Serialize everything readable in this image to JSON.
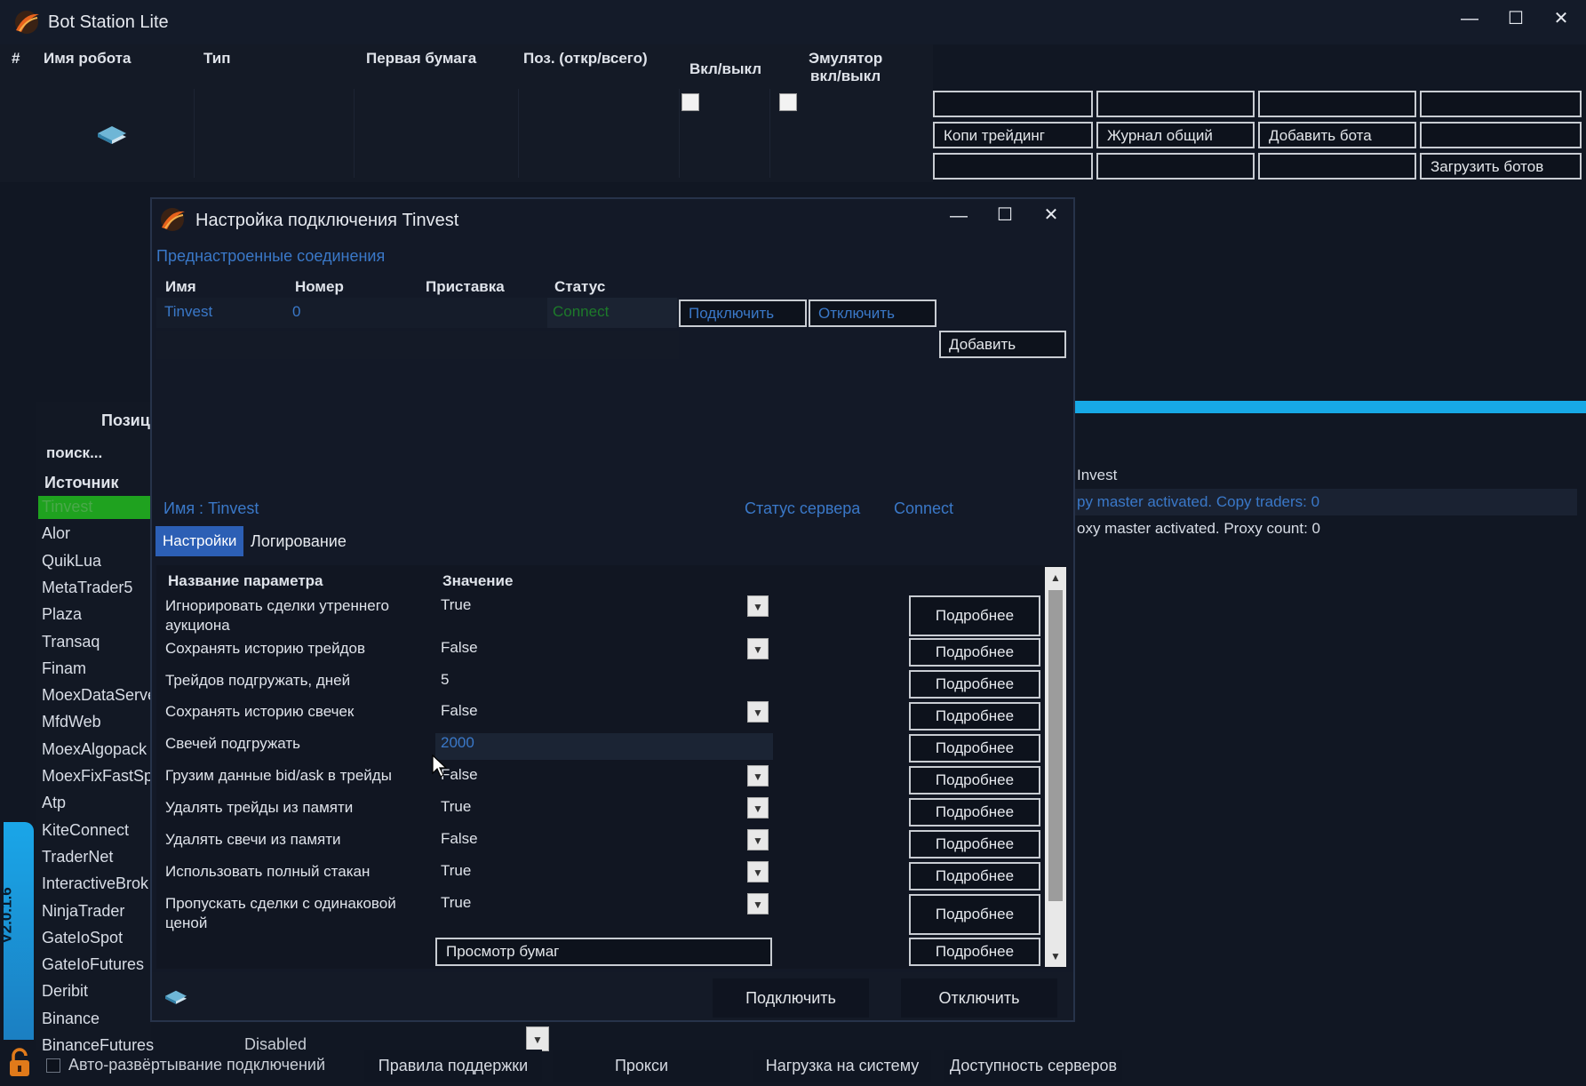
{
  "app": {
    "title": "Bot Station Lite",
    "minimize": "—",
    "maximize": "☐",
    "close": "✕"
  },
  "main_grid": {
    "headers": {
      "num": "#",
      "robot_name": "Имя робота",
      "type": "Тип",
      "first_security": "Первая бумага",
      "positions": "Поз. (откр/всего)",
      "onoff": "Вкл/выкл",
      "emulator_line1": "Эмулятор",
      "emulator_line2": "вкл/выкл"
    }
  },
  "top_buttons": {
    "copy_trading": "Копи трейдинг",
    "journal": "Журнал общий",
    "add_bot": "Добавить бота",
    "load_bots": "Загрузить ботов"
  },
  "sidebar": {
    "positions_tab": "Позиц",
    "search": "поиск...",
    "source_header": "Источник",
    "items": [
      "Tinvest",
      "Alor",
      "QuikLua",
      "MetaTrader5",
      "Plaza",
      "Transaq",
      "Finam",
      "MoexDataServe",
      "MfdWeb",
      "MoexAlgopack",
      "MoexFixFastSp",
      "Atp",
      "KiteConnect",
      "TraderNet",
      "InteractiveBrok",
      "NinjaTrader",
      "GateIoSpot",
      "GateIoFutures",
      "Deribit",
      "Binance",
      "BinanceFutures"
    ],
    "last_state": "Disabled",
    "version": "V2.0.1.6"
  },
  "log_panel": {
    "line1": "Invest",
    "line2": "py master activated. Copy traders: 0",
    "line3": "oxy master activated. Proxy count: 0"
  },
  "footer": {
    "auto_deploy": "Авто-развёртывание подключений",
    "support_rules": "Правила поддержки",
    "proxy": "Прокси",
    "system_load": "Нагрузка на систему",
    "server_availability": "Доступность серверов"
  },
  "dialog": {
    "title": "Настройка подключения Tinvest",
    "preset_link": "Преднастроенные соединения",
    "headers": {
      "name": "Имя",
      "number": "Номер",
      "prefix": "Приставка",
      "status": "Статус"
    },
    "row": {
      "name": "Tinvest",
      "number": "0",
      "prefix": "",
      "status": "Connect"
    },
    "connect_btn": "Подключить",
    "disconnect_btn": "Отключить",
    "add_btn": "Добавить",
    "name_label": "Имя : Tinvest",
    "server_status_label": "Статус сервера",
    "server_status_value": "Connect",
    "tabs": {
      "settings": "Настройки",
      "logging": "Логирование"
    },
    "param_headers": {
      "name": "Название параметра",
      "value": "Значение"
    },
    "params": [
      {
        "name": "Игнорировать сделки утреннего аукциона",
        "value": "True",
        "dropdown": true
      },
      {
        "name": "Сохранять историю трейдов",
        "value": "False",
        "dropdown": true
      },
      {
        "name": "Трейдов подгружать, дней",
        "value": "5",
        "dropdown": false
      },
      {
        "name": "Сохранять историю свечек",
        "value": "False",
        "dropdown": true
      },
      {
        "name": "Свечей подгружать",
        "value": "2000",
        "dropdown": false
      },
      {
        "name": "Грузим данные bid/ask в трейды",
        "value": "False",
        "dropdown": true
      },
      {
        "name": "Удалять трейды из памяти",
        "value": "True",
        "dropdown": true
      },
      {
        "name": "Удалять свечи из памяти",
        "value": "False",
        "dropdown": true
      },
      {
        "name": "Использовать полный стакан",
        "value": "True",
        "dropdown": true
      },
      {
        "name": "Пропускать сделки с одинаковой ценой",
        "value": "True",
        "dropdown": true
      }
    ],
    "view_securities_btn": "Просмотр бумаг",
    "more_label": "Подробнее",
    "bottom_connect": "Подключить",
    "bottom_disconnect": "Отключить"
  },
  "colors": {
    "accent_blue": "#3a78c8",
    "selected_green": "#1fa21f",
    "progress_cyan": "#17a9e6",
    "tab_active": "#2c5fb5"
  }
}
